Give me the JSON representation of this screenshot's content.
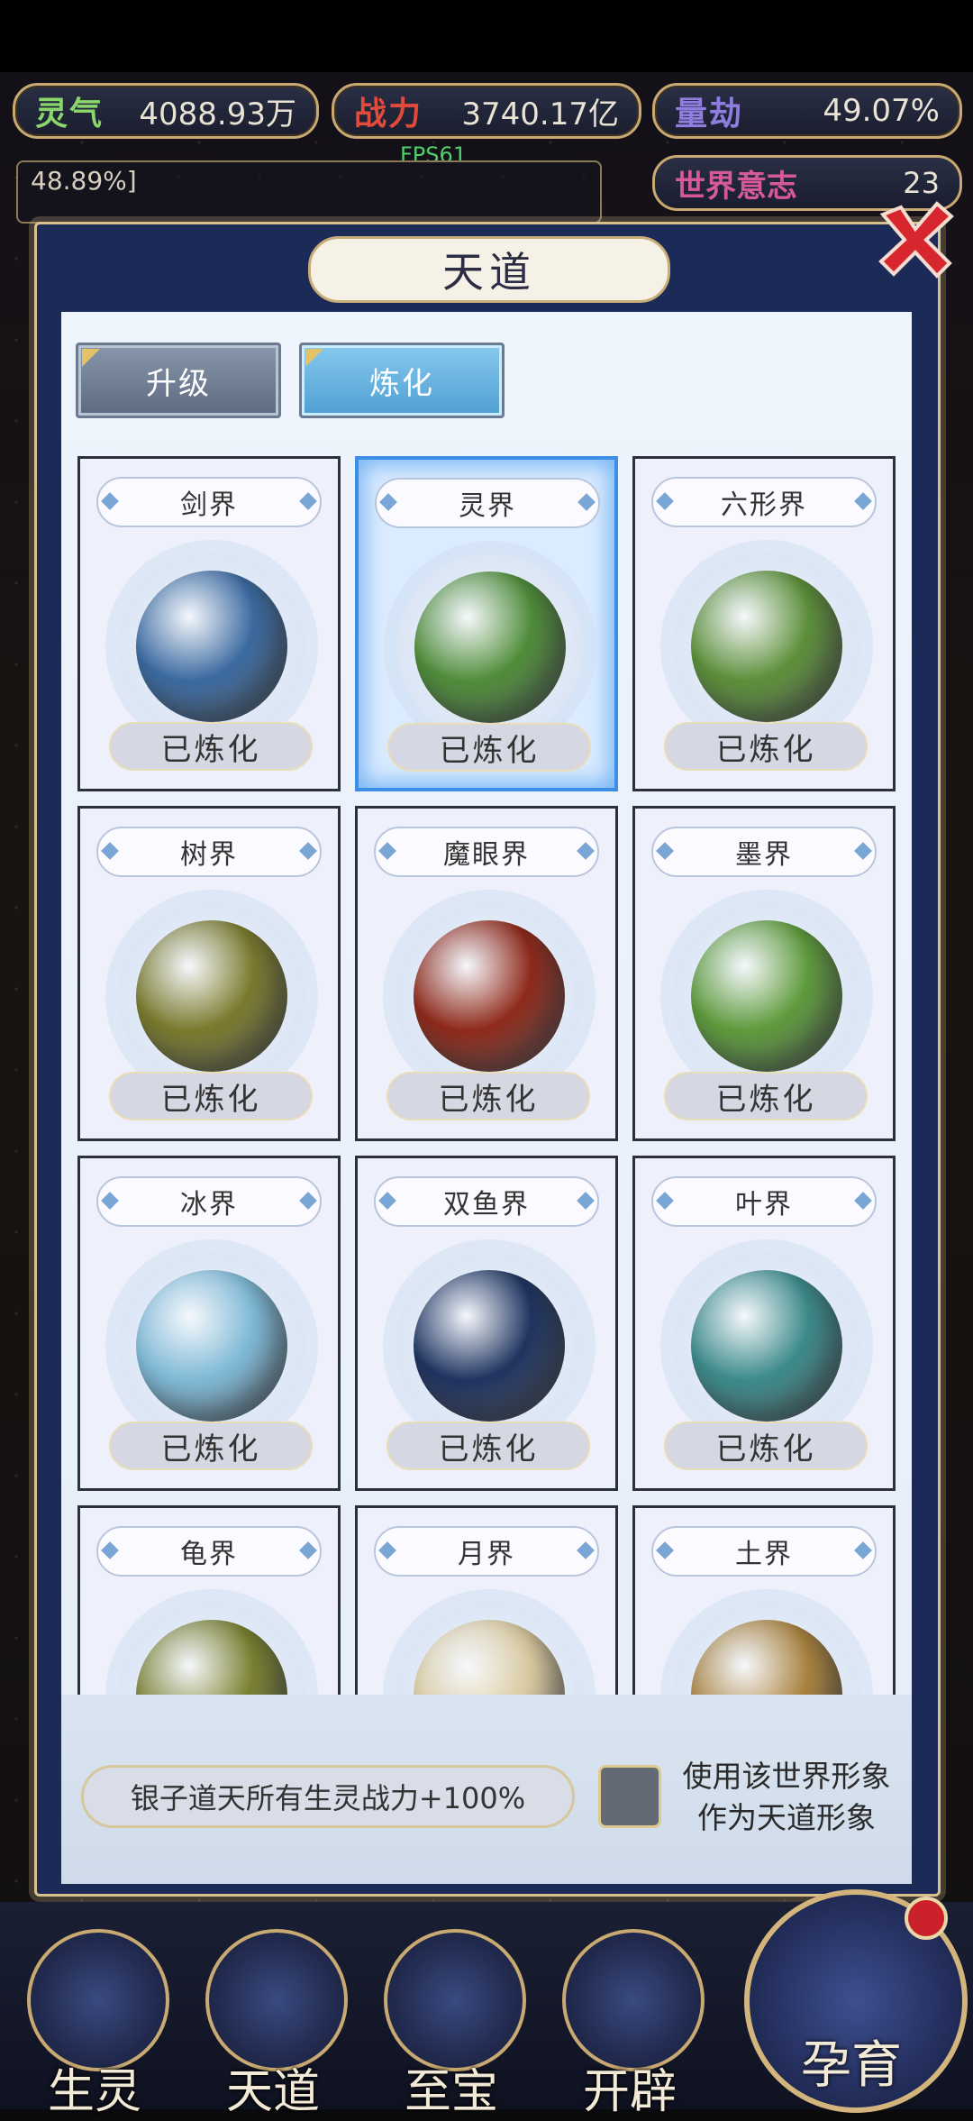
{
  "stats": {
    "lingqi": {
      "label": "灵气",
      "value": "4088.93万"
    },
    "zhanli": {
      "label": "战力",
      "value": "3740.17亿"
    },
    "liangjie": {
      "label": "量劫",
      "value": "49.07%"
    },
    "world_will": {
      "label": "世界意志",
      "value": "23"
    }
  },
  "fps": "FPS61",
  "message": "48.89%]",
  "panel": {
    "title": "天道",
    "tabs": [
      {
        "label": "升级"
      },
      {
        "label": "炼化"
      }
    ]
  },
  "worlds": [
    {
      "name": "剑界",
      "status": "已炼化",
      "color": "#3b6aa0"
    },
    {
      "name": "灵界",
      "status": "已炼化",
      "color": "#4f8c3a"
    },
    {
      "name": "六形界",
      "status": "已炼化",
      "color": "#5d8f3a"
    },
    {
      "name": "树界",
      "status": "已炼化",
      "color": "#7a7a2e"
    },
    {
      "name": "魔眼界",
      "status": "已炼化",
      "color": "#8e2a1b"
    },
    {
      "name": "墨界",
      "status": "已炼化",
      "color": "#5e9a3c"
    },
    {
      "name": "冰界",
      "status": "已炼化",
      "color": "#7fb9d6"
    },
    {
      "name": "双鱼界",
      "status": "已炼化",
      "color": "#1f3460"
    },
    {
      "name": "叶界",
      "status": "已炼化",
      "color": "#3c8a8a"
    },
    {
      "name": "龟界",
      "status": "",
      "color": "#7a8030"
    },
    {
      "name": "月界",
      "status": "",
      "color": "#d9c9a0"
    },
    {
      "name": "土界",
      "status": "",
      "color": "#a8823e"
    }
  ],
  "bottom": {
    "bonus": "银子道天所有生灵战力+100%",
    "checkbox_label_line1": "使用该世界形象",
    "checkbox_label_line2": "作为天道形象"
  },
  "nav": {
    "items": [
      {
        "label": "生灵"
      },
      {
        "label": "天道"
      },
      {
        "label": "至宝"
      },
      {
        "label": "开辟"
      }
    ],
    "main": {
      "label": "孕育"
    }
  }
}
